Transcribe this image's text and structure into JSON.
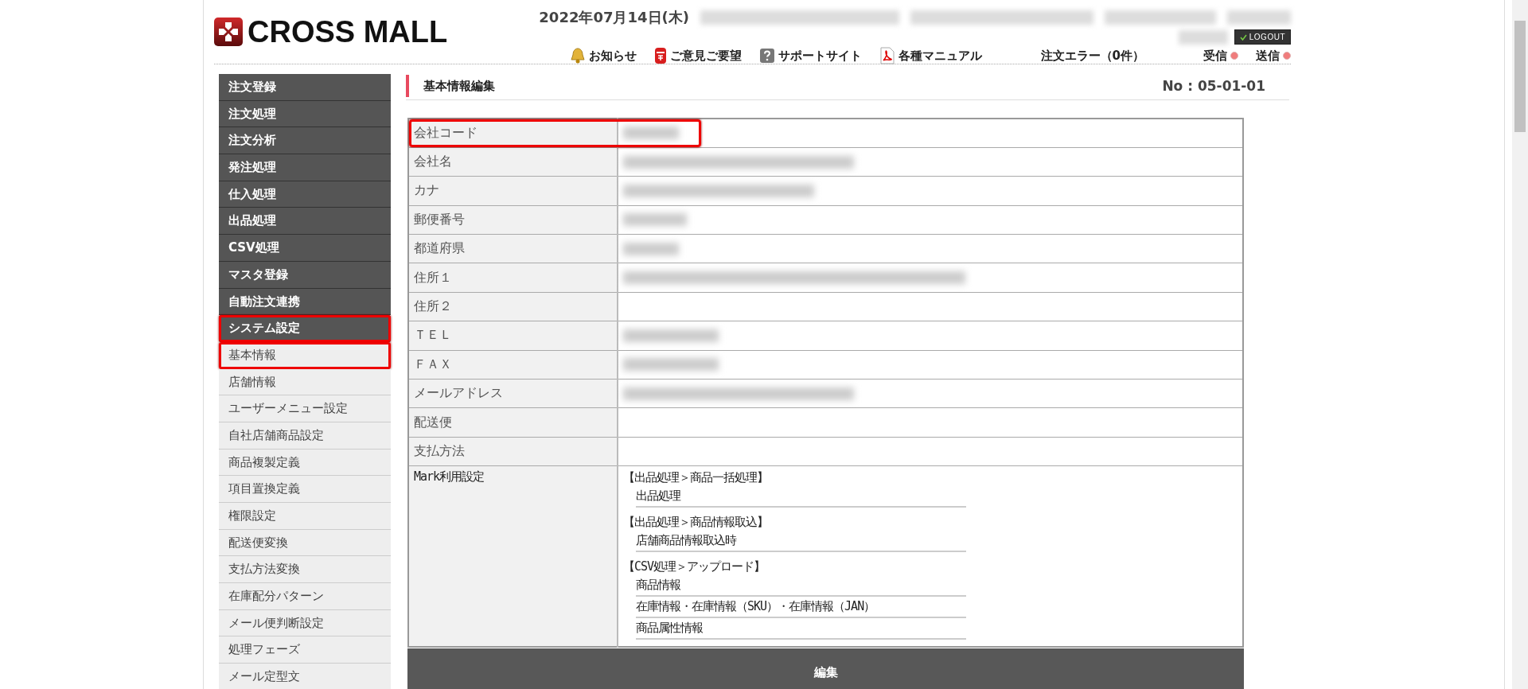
{
  "header": {
    "logo": "CROSS MALL",
    "date": "2022年07月14日(木)",
    "user_info_blurred": true,
    "logout": "LOGOUT",
    "nav": [
      {
        "label": "お知らせ",
        "kind": "bell"
      },
      {
        "label": "ご意見ご要望",
        "kind": "postbox"
      },
      {
        "label": "サポートサイト",
        "kind": "help"
      },
      {
        "label": "各種マニュアル",
        "kind": "pdf"
      },
      {
        "label": "注文エラー（0件）",
        "kind": "text"
      },
      {
        "label": "受信",
        "kind": "status"
      },
      {
        "label": "送信",
        "kind": "status"
      }
    ]
  },
  "sidebar": {
    "items": [
      {
        "label": "注文登録",
        "kind": "category",
        "highlighted": false
      },
      {
        "label": "注文処理",
        "kind": "category",
        "highlighted": false
      },
      {
        "label": "注文分析",
        "kind": "category",
        "highlighted": false
      },
      {
        "label": "発注処理",
        "kind": "category",
        "highlighted": false
      },
      {
        "label": "仕入処理",
        "kind": "category",
        "highlighted": false
      },
      {
        "label": "出品処理",
        "kind": "category",
        "highlighted": false
      },
      {
        "label": "CSV処理",
        "kind": "category",
        "highlighted": false
      },
      {
        "label": "マスタ登録",
        "kind": "category",
        "highlighted": false
      },
      {
        "label": "自動注文連携",
        "kind": "category",
        "highlighted": false
      },
      {
        "label": "システム設定",
        "kind": "category",
        "highlighted": true
      },
      {
        "label": "基本情報",
        "kind": "sub",
        "highlighted": true
      },
      {
        "label": "店舗情報",
        "kind": "sub",
        "highlighted": false
      },
      {
        "label": "ユーザーメニュー設定",
        "kind": "sub",
        "highlighted": false
      },
      {
        "label": "自社店舗商品設定",
        "kind": "sub",
        "highlighted": false
      },
      {
        "label": "商品複製定義",
        "kind": "sub",
        "highlighted": false
      },
      {
        "label": "項目置換定義",
        "kind": "sub",
        "highlighted": false
      },
      {
        "label": "権限設定",
        "kind": "sub",
        "highlighted": false
      },
      {
        "label": "配送便変換",
        "kind": "sub",
        "highlighted": false
      },
      {
        "label": "支払方法変換",
        "kind": "sub",
        "highlighted": false
      },
      {
        "label": "在庫配分パターン",
        "kind": "sub",
        "highlighted": false
      },
      {
        "label": "メール便判断設定",
        "kind": "sub",
        "highlighted": false
      },
      {
        "label": "処理フェーズ",
        "kind": "sub",
        "highlighted": false
      },
      {
        "label": "メール定型文",
        "kind": "sub",
        "highlighted": false
      }
    ]
  },
  "page": {
    "title": "基本情報編集",
    "number": "No : 05-01-01"
  },
  "form": {
    "rows": [
      {
        "label": "会社コード",
        "value_blurred": true,
        "highlighted": true
      },
      {
        "label": "会社名",
        "value_blurred": true,
        "highlighted": false
      },
      {
        "label": "カナ",
        "value_blurred": true,
        "highlighted": false
      },
      {
        "label": "郵便番号",
        "value_blurred": true,
        "highlighted": false
      },
      {
        "label": "都道府県",
        "value_blurred": true,
        "highlighted": false
      },
      {
        "label": "住所１",
        "value_blurred": true,
        "highlighted": false
      },
      {
        "label": "住所２",
        "value_blurred": false,
        "highlighted": false
      },
      {
        "label": "ＴＥＬ",
        "value_blurred": true,
        "highlighted": false
      },
      {
        "label": "ＦＡＸ",
        "value_blurred": true,
        "highlighted": false
      },
      {
        "label": "メールアドレス",
        "value_blurred": true,
        "highlighted": false
      },
      {
        "label": "配送便",
        "value_blurred": false,
        "highlighted": false
      },
      {
        "label": "支払方法",
        "value_blurred": false,
        "highlighted": false
      }
    ],
    "mark": {
      "label": "Mark利用設定",
      "sections": [
        {
          "heading": "【出品処理＞商品一括処理】",
          "items": [
            "出品処理"
          ]
        },
        {
          "heading": "【出品処理＞商品情報取込】",
          "items": [
            "店舗商品情報取込時"
          ]
        },
        {
          "heading": "【CSV処理＞アップロード】",
          "items": [
            "商品情報",
            "在庫情報・在庫情報（SKU）・在庫情報（JAN）",
            "商品属性情報"
          ]
        }
      ]
    }
  },
  "edit_button": "編集"
}
